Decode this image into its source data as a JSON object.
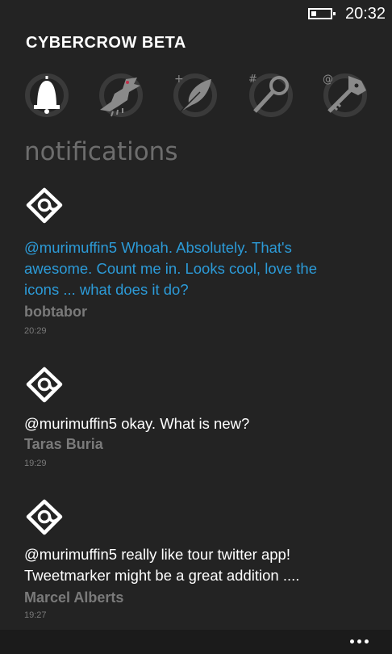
{
  "status": {
    "time": "20:32"
  },
  "app": {
    "title": "CYBERCROW BETA"
  },
  "pivots": [
    "notifications",
    "timeline",
    "compose",
    "search",
    "lists"
  ],
  "section": {
    "title": "notifications"
  },
  "notifications": [
    {
      "message": "@murimuffin5 Whoah.  Absolutely.  That's awesome.  Count me in.  Looks cool, love the icons ... what does it do?",
      "author": "bobtabor",
      "time": "20:29",
      "color": "#2c9bd8"
    },
    {
      "message": "@murimuffin5 okay. What is new?",
      "author": "Taras Buria",
      "time": "19:29",
      "color": "#ffffff"
    },
    {
      "message": "@murimuffin5 really like tour twitter app! Tweetmarker might be a great addition ....",
      "author": "Marcel Alberts",
      "time": "19:27",
      "color": "#ffffff"
    }
  ],
  "appbar": {
    "more_icon": "ellipsis-icon"
  }
}
